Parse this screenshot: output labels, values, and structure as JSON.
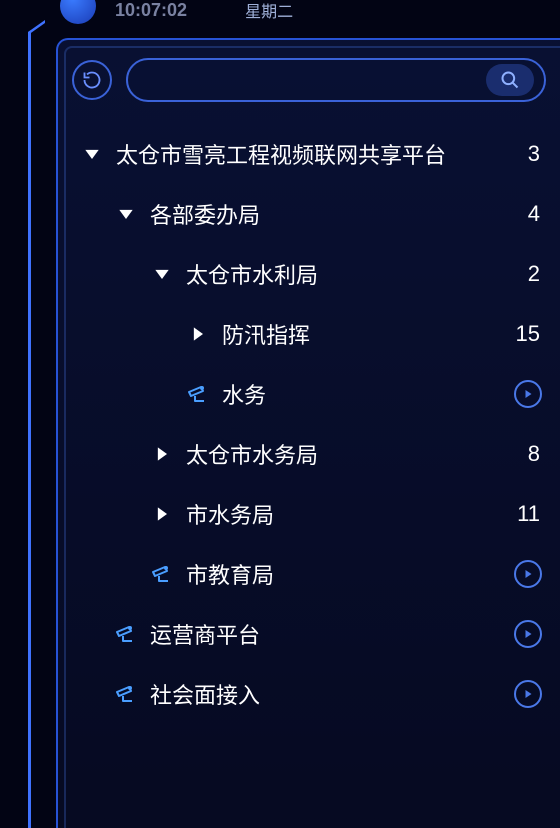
{
  "header": {
    "time_partial": "10:07:02",
    "day_label": "星期二"
  },
  "toolbar": {
    "search_placeholder": ""
  },
  "tree": {
    "nodes": [
      {
        "depth": 0,
        "icon": "triangle-down",
        "label": "太仓市雪亮工程视频联网共享平台",
        "trailing_type": "count",
        "count": 3
      },
      {
        "depth": 1,
        "icon": "triangle-down",
        "label": "各部委办局",
        "trailing_type": "count",
        "count": 4
      },
      {
        "depth": 2,
        "icon": "triangle-down",
        "label": "太仓市水利局",
        "trailing_type": "count",
        "count": 2
      },
      {
        "depth": 3,
        "icon": "triangle-right",
        "label": "防汛指挥",
        "trailing_type": "count",
        "count": 15
      },
      {
        "depth": 3,
        "icon": "camera",
        "label": "水务",
        "trailing_type": "play"
      },
      {
        "depth": 2,
        "icon": "triangle-right",
        "label": "太仓市水务局",
        "trailing_type": "count",
        "count": 8
      },
      {
        "depth": 2,
        "icon": "triangle-right",
        "label": "市水务局",
        "trailing_type": "count",
        "count": 11
      },
      {
        "depth": 2,
        "icon": "camera",
        "label": "市教育局",
        "trailing_type": "play"
      },
      {
        "depth": 1,
        "icon": "camera",
        "label": "运营商平台",
        "trailing_type": "play"
      },
      {
        "depth": 1,
        "icon": "camera",
        "label": "社会面接入",
        "trailing_type": "play"
      }
    ]
  }
}
